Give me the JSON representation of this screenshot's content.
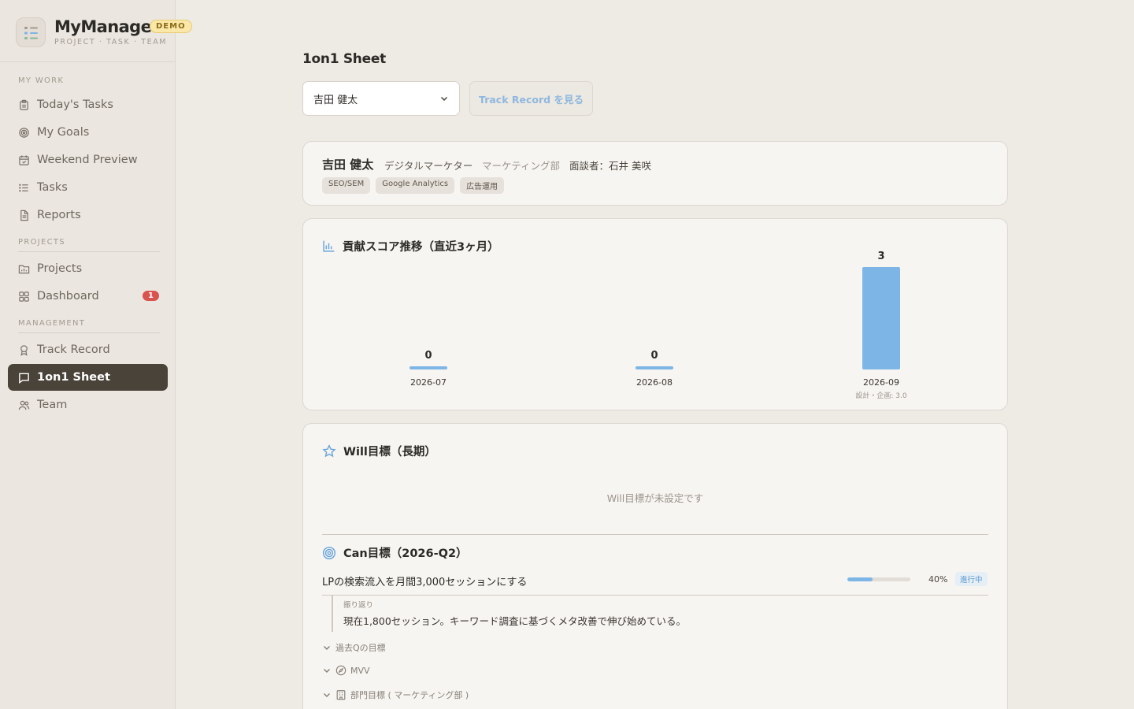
{
  "app": {
    "name": "MyManager",
    "badge": "DEMO",
    "subtitle": "PROJECT · TASK · TEAM"
  },
  "sidebar": {
    "sections": {
      "my_work": "MY WORK",
      "projects": "PROJECTS",
      "management": "MANAGEMENT"
    },
    "items": [
      {
        "label": "Today's Tasks",
        "icon": "clipboard-icon"
      },
      {
        "label": "My Goals",
        "icon": "target-icon"
      },
      {
        "label": "Weekend Preview",
        "icon": "calendar-icon"
      },
      {
        "label": "Tasks",
        "icon": "list-icon"
      },
      {
        "label": "Reports",
        "icon": "document-icon"
      },
      {
        "label": "Projects",
        "icon": "folder-icon"
      },
      {
        "label": "Dashboard",
        "icon": "grid-icon",
        "badge": "1"
      },
      {
        "label": "Track Record",
        "icon": "award-icon"
      },
      {
        "label": "1on1 Sheet",
        "icon": "chat-icon",
        "active": true
      },
      {
        "label": "Team",
        "icon": "users-icon"
      }
    ]
  },
  "main": {
    "title": "1on1 Sheet",
    "member_select": {
      "value": "吉田 健太"
    },
    "track_button": "Track Record を見る"
  },
  "profile": {
    "name": "吉田 健太",
    "role": "デジタルマーケター",
    "department": "マーケティング部",
    "interviewer": "面談者：石井 美咲",
    "tags": [
      "SEO/SEM",
      "Google Analytics",
      "広告運用"
    ]
  },
  "score_card": {
    "heading": "貢献スコア推移（直近3ヶ月）"
  },
  "chart_data": {
    "type": "bar",
    "categories": [
      "2026-07",
      "2026-08",
      "2026-09"
    ],
    "values": [
      0,
      0,
      3
    ],
    "data_labels": [
      "0",
      "0",
      "3"
    ],
    "annotations": [
      "",
      "",
      "設計・企画: 3.0"
    ],
    "title": "貢献スコア推移（直近3ヶ月）",
    "xlabel": "",
    "ylabel": "",
    "ylim": [
      0,
      3
    ],
    "grid": false,
    "color": "#7db6e6"
  },
  "will": {
    "heading": "Will目標（長期）",
    "empty": "Will目標が未設定です"
  },
  "can": {
    "heading": "Can目標（2026-Q2）",
    "goal": {
      "text": "LPの検索流入を月間3,000セッションにする",
      "progress": 40,
      "progress_label": "40%",
      "status": "進行中"
    },
    "reflection": {
      "label": "振り返り",
      "text": "現在1,800セッション。キーワード調査に基づくメタ改善で伸び始めている。"
    },
    "collapsibles": {
      "past": "過去Qの目標",
      "mvv": "MVV",
      "dept": "部門目標 ( マーケティング部 )"
    }
  },
  "colors": {
    "accent": "#7db6e6",
    "active_nav": "#4a4339",
    "badge_red": "#d9534f",
    "demo_badge": "#fbe7a8"
  }
}
